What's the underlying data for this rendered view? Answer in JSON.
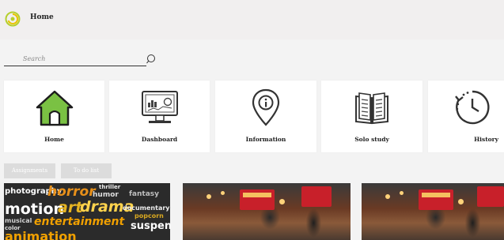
{
  "header": {
    "title": "Home"
  },
  "search": {
    "placeholder": "Search"
  },
  "tiles": [
    {
      "label": "Home",
      "icon": "house-icon"
    },
    {
      "label": "Dashboard",
      "icon": "monitor-chart-icon"
    },
    {
      "label": "Information",
      "icon": "info-pin-icon"
    },
    {
      "label": "Solo study",
      "icon": "book-icon"
    },
    {
      "label": "History",
      "icon": "history-clock-icon"
    }
  ],
  "buttons": {
    "assignments": "Assignments",
    "to_do_list": "To do list"
  },
  "colors": {
    "house": "#7ac143",
    "logo_outer": "#b5cf2d",
    "logo_inner": "#e9c300"
  },
  "cards": {
    "words": [
      "photography",
      "horror",
      "thriller",
      "humor",
      "fantasy",
      "motion",
      "art",
      "drama",
      "documentary",
      "popcorn",
      "musical",
      "entertainment",
      "suspense",
      "color",
      "animation"
    ]
  }
}
